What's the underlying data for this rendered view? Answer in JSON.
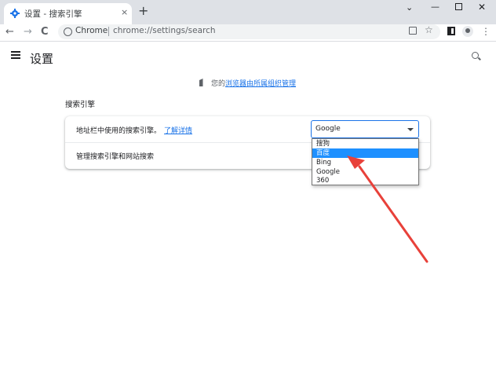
{
  "tab": {
    "title": "设置 - 搜索引擎",
    "close": "×",
    "new_tab": "+"
  },
  "window": {
    "chevron": "⌄",
    "minimize": "—",
    "close": "✕"
  },
  "toolbar": {
    "back": "←",
    "forward": "→",
    "reload": "C",
    "omnibox_label": "Chrome",
    "omnibox_url": "chrome://settings/search",
    "star": "☆",
    "menu": "⋮"
  },
  "header": {
    "title": "设置"
  },
  "managed": {
    "prefix": "您的",
    "link": "浏览器由所属组织管理"
  },
  "section": {
    "title": "搜索引擎"
  },
  "card": {
    "row1_label": "地址栏中使用的搜索引擎。",
    "learn_more": "了解详情",
    "row2_label": "管理搜索引擎和网站搜索"
  },
  "engine_select": {
    "value": "Google",
    "options": [
      "搜狗",
      "百度",
      "Bing",
      "Google",
      "360"
    ],
    "highlighted": "百度"
  },
  "colors": {
    "link": "#1a73e8",
    "highlight": "#1e90ff",
    "arrow": "#e8413a"
  }
}
